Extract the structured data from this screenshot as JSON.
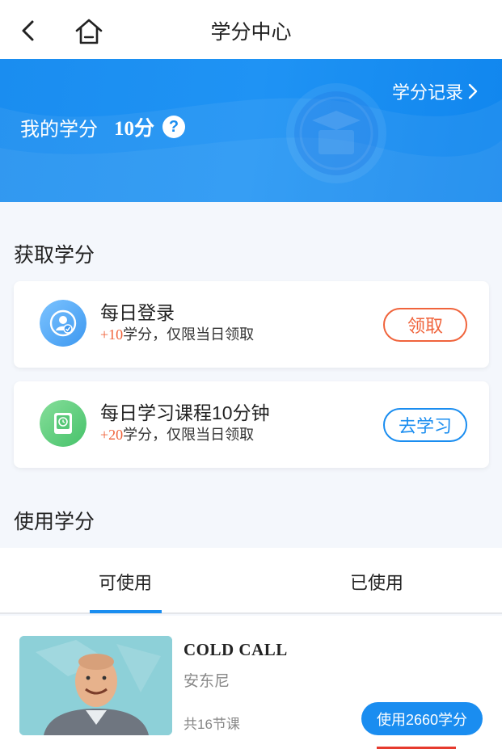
{
  "header": {
    "title": "学分中心",
    "back_icon": "chevron-left-icon",
    "home_icon": "home-icon"
  },
  "banner": {
    "label": "我的学分",
    "value": "10分",
    "help": "?",
    "records_link": "学分记录",
    "colors": {
      "accent": "#1a8df0"
    }
  },
  "earn": {
    "title": "获取学分",
    "tasks": [
      {
        "title": "每日登录",
        "plus": "+10",
        "desc": "学分，仅限当日领取",
        "button": "领取",
        "icon": "user-check-icon",
        "button_color": "#f0643c"
      },
      {
        "title": "每日学习课程10分钟",
        "plus": "+20",
        "desc": "学分，仅限当日领取",
        "button": "去学习",
        "icon": "book-clock-icon",
        "button_color": "#1a8df0"
      }
    ]
  },
  "use": {
    "title": "使用学分",
    "tabs": [
      {
        "label": "可使用",
        "active": true
      },
      {
        "label": "已使用",
        "active": false
      }
    ],
    "courses": [
      {
        "title": "COLD CALL",
        "teacher": "安东尼",
        "lessons": "共16节课",
        "button": "使用2660学分"
      }
    ]
  }
}
